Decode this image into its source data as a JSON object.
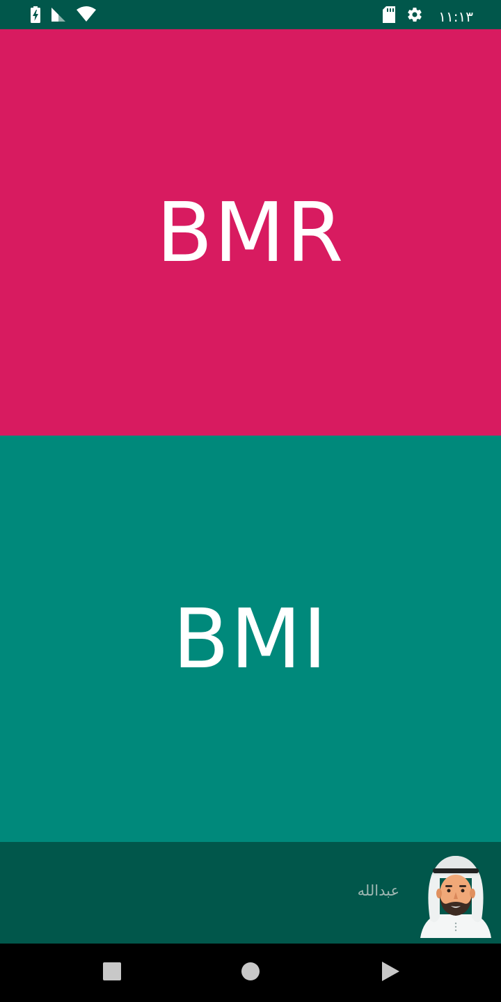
{
  "status_bar": {
    "time": "١١:١٣",
    "icons": [
      "battery-charging-icon",
      "cell-signal-icon",
      "wifi-icon",
      "sd-card-icon",
      "settings-gear-icon"
    ]
  },
  "panels": {
    "bmr": {
      "label": "BMR",
      "color": "#d81b60"
    },
    "bmi": {
      "label": "BMI",
      "color": "#00897b"
    }
  },
  "footer": {
    "name": "عبدالله",
    "avatar_icon": "avatar-man-ghutra-icon",
    "background": "#01574b"
  },
  "nav_bar": {
    "buttons": [
      "recents-square-icon",
      "home-circle-icon",
      "back-triangle-icon"
    ]
  }
}
